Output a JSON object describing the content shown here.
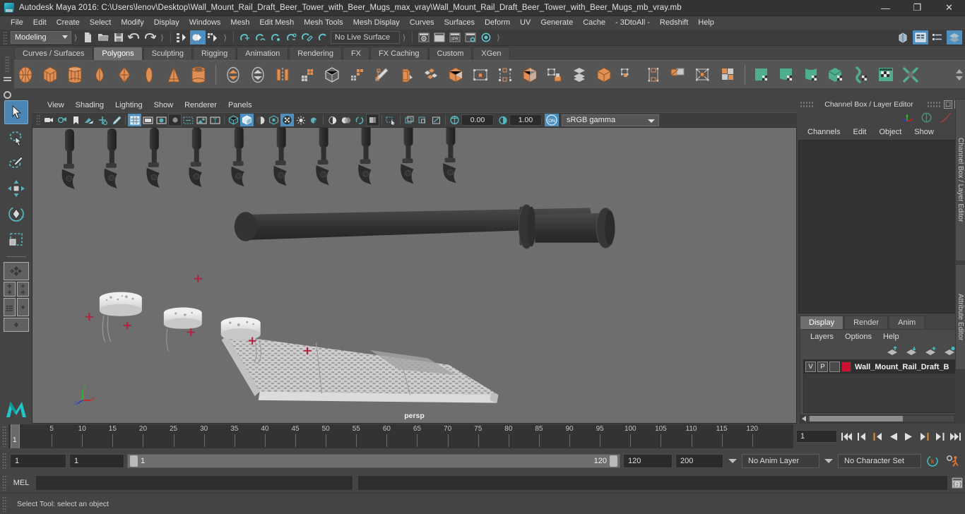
{
  "window": {
    "title": "Autodesk Maya 2016: C:\\Users\\lenov\\Desktop\\Wall_Mount_Rail_Draft_Beer_Tower_with_Beer_Mugs_max_vray\\Wall_Mount_Rail_Draft_Beer_Tower_with_Beer_Mugs_mb_vray.mb",
    "minimize": "—",
    "maximize": "❐",
    "close": "✕"
  },
  "menubar": {
    "items": [
      "File",
      "Edit",
      "Create",
      "Select",
      "Modify",
      "Display",
      "Windows",
      "Mesh",
      "Edit Mesh",
      "Mesh Tools",
      "Mesh Display",
      "Curves",
      "Surfaces",
      "Deform",
      "UV",
      "Generate",
      "Cache",
      "- 3DtoAll -",
      "Redshift",
      "Help"
    ]
  },
  "statusline": {
    "menu_set": "Modeling",
    "live_surface": "No Live Surface",
    "icons": [
      "new-scene-icon",
      "open-scene-icon",
      "save-scene-icon",
      "undo-icon",
      "redo-icon",
      "select-hierarchy-icon",
      "select-object-icon",
      "select-component-icon",
      "snap-grid-icon",
      "snap-curve-icon",
      "snap-point-icon",
      "snap-projected-icon",
      "snap-view-plane-icon",
      "make-live-icon",
      "render-view-icon",
      "render-current-frame-icon",
      "ipr-render-icon",
      "render-settings-icon",
      "hypershade-icon"
    ],
    "right_icons": [
      "show-hide-modeling-toolkit-icon",
      "show-hide-attribute-editor-icon",
      "show-hide-tool-settings-icon",
      "show-hide-channel-box-icon"
    ],
    "ipr_label": "IPR"
  },
  "shelf": {
    "tabs": [
      "Curves / Surfaces",
      "Polygons",
      "Sculpting",
      "Rigging",
      "Animation",
      "Rendering",
      "FX",
      "FX Caching",
      "Custom",
      "XGen"
    ],
    "active_tab": "Polygons",
    "orange_icons": [
      "poly-sphere-icon",
      "poly-cube-icon",
      "poly-cylinder-icon",
      "poly-cone-icon",
      "poly-torus-icon",
      "poly-plane-icon",
      "poly-pyramid-icon",
      "poly-pipe-icon"
    ],
    "gray_icons": [
      "poly-combine-icon",
      "poly-separate-icon",
      "poly-mirror-icon",
      "poly-smooth-icon",
      "poly-extract-icon",
      "poly-reduce-icon",
      "poly-crease-icon",
      "poly-bevel-icon",
      "poly-multi-cut-icon",
      "poly-bridge-icon",
      "poly-append-icon",
      "poly-offset-edge-icon",
      "poly-connect-icon",
      "poly-merge-icon",
      "poly-target-weld-icon",
      "poly-fill-hole-icon"
    ],
    "green_icons": [
      "uv-planar-icon",
      "uv-cylindrical-icon",
      "uv-spherical-icon",
      "uv-automatic-icon",
      "uv-contour-stretch-icon",
      "uv-editor-icon",
      "uv-cut-sew-icon"
    ]
  },
  "toolbox": {
    "tools": [
      "select-tool",
      "lasso-select-tool",
      "paint-select-tool",
      "move-tool",
      "rotate-tool",
      "scale-tool"
    ],
    "layouts": [
      "single-perspective-view-layout",
      "four-view-layout",
      "outliner-persp-layout",
      "hypergraph-persp-layout",
      "persp-graph-layout"
    ],
    "active_tool": "select-tool"
  },
  "viewport": {
    "menus": [
      "View",
      "Shading",
      "Lighting",
      "Show",
      "Renderer",
      "Panels"
    ],
    "camera_label": "persp",
    "exposure": "0.00",
    "gamma": "1.00",
    "color_management": "sRGB gamma",
    "toolbar_icons": [
      "select-camera-icon",
      "lock-camera-icon",
      "bookmark-icon",
      "image-plane-icon",
      "2d-pan-zoom-icon",
      "grease-pencil-icon",
      "grid-icon",
      "film-gate-icon",
      "resolution-gate-icon",
      "gate-mask-icon",
      "field-chart-icon",
      "safe-action-icon",
      "safe-title-icon",
      "wireframe-icon",
      "smooth-shade-icon",
      "flat-shade-icon",
      "shaded-wireframe-icon",
      "textured-icon",
      "lights-icon",
      "shadows-icon",
      "screen-space-ao-icon",
      "motion-blur-icon",
      "multisample-icon",
      "depth-of-field-icon",
      "isolate-select-icon",
      "xray-icon",
      "xray-joints-icon",
      "xray-active-components-icon",
      "exposure-icon",
      "gamma-icon",
      "color-management-icon"
    ],
    "axis": {
      "x": "x",
      "y": "y",
      "z": "z"
    }
  },
  "channel_box": {
    "panel_title": "Channel Box / Layer Editor",
    "menus": [
      "Channels",
      "Edit",
      "Object",
      "Show"
    ],
    "icons": [
      "channel-box-icon",
      "attribute-editor-icon",
      "tool-settings-icon"
    ],
    "vertical_tabs": [
      "Channel Box / Layer Editor",
      "Attribute Editor"
    ]
  },
  "layer_editor": {
    "tabs": [
      "Display",
      "Render",
      "Anim"
    ],
    "active_tab": "Display",
    "menus": [
      "Layers",
      "Options",
      "Help"
    ],
    "buttons": [
      "move-layer-up-icon",
      "move-layer-down-icon",
      "new-layer-icon",
      "new-layer-from-selected-icon"
    ],
    "layers": [
      {
        "visibility": "V",
        "playback": "P",
        "type": "",
        "color": "#cc1133",
        "name": "Wall_Mount_Rail_Draft_B"
      }
    ]
  },
  "timeline": {
    "ticks": [
      5,
      10,
      15,
      20,
      25,
      30,
      35,
      40,
      45,
      50,
      55,
      60,
      65,
      70,
      75,
      80,
      85,
      90,
      95,
      100,
      105,
      110,
      115,
      120
    ],
    "current_frame": "1",
    "frame_field": "1",
    "playback_buttons": [
      "go-to-start-icon",
      "step-back-keyframe-icon",
      "step-back-frame-icon",
      "play-backwards-icon",
      "play-forwards-icon",
      "step-forward-frame-icon",
      "step-forward-keyframe-icon",
      "go-to-end-icon"
    ]
  },
  "range": {
    "anim_start": "1",
    "range_start": "1",
    "slider_min": "1",
    "slider_max": "120",
    "range_end": "120",
    "anim_end": "200",
    "anim_layer": "No Anim Layer",
    "character_set": "No Character Set",
    "icons": [
      "auto-key-icon",
      "animation-preferences-icon"
    ]
  },
  "command_line": {
    "language": "MEL",
    "input_value": "",
    "output_value": "",
    "script_editor_icon": "script-editor-icon"
  },
  "statusbar": {
    "help_text": "Select Tool: select an object"
  },
  "colors": {
    "accent_blue": "#4f8fbf",
    "shelf_orange": "#e08a4e",
    "shelf_green": "#4fae8f",
    "layer_swatch": "#cc1133",
    "viewport_bg": "#6e6e6e"
  }
}
